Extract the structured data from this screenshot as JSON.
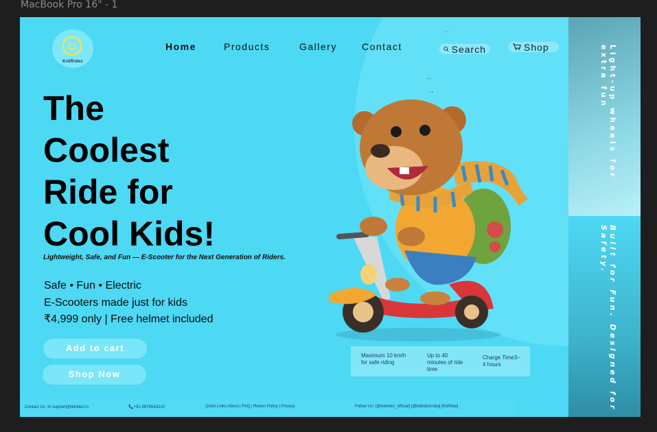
{
  "frame_label": "MacBook Pro 16\" - 1",
  "logo": {
    "text": "KidRidez",
    "icon": "smiley-icon"
  },
  "nav": {
    "home": "Home",
    "products": "Products",
    "gallery": "Gallery",
    "contact": "Contact",
    "search": "Search",
    "shop": "Shop"
  },
  "hero": {
    "headline": [
      "The",
      "Coolest",
      "Ride for",
      "Cool Kids!"
    ],
    "tagline": "Lightweight, Safe, and Fun — E-Scooter for the Next Generation of Riders.",
    "features": [
      "Safe • Fun • Electric",
      "E-Scooters made just for kids",
      "₹4,999 only | Free helmet included"
    ],
    "add_to_cart": "Add to cart",
    "shop_now": "Shop Now"
  },
  "specs": {
    "speed": [
      "Maximum 10 km/h",
      "for safe riding"
    ],
    "battery": [
      "Up to 40",
      "minutes of ride",
      "time"
    ],
    "charge": [
      "Charge Time3–",
      "4 hours"
    ]
  },
  "side": {
    "top_text": "Light-up wheels for extra fun",
    "bottom_text": "Built for Fun. Designed for Safety."
  },
  "footer": {
    "contact": "Contact Us: ✉ support@kidridez.in",
    "phone": "📞+91-9876543210",
    "links": "Quick Links:About | FAQ | Return Policy | Privacy",
    "social": "Follow Us: [@kidridez_official] [@kidridezindia] [KidRide]"
  },
  "colors": {
    "background": "#4dd8f4",
    "button": "#7be6f8",
    "text": "#000000"
  }
}
